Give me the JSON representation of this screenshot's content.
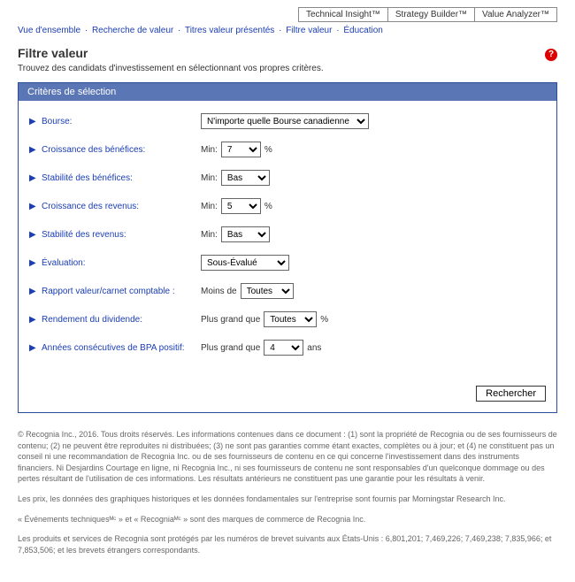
{
  "tabs": {
    "technical": "Technical Insight™",
    "strategy": "Strategy Builder™",
    "value": "Value Analyzer™"
  },
  "breadcrumbs": {
    "overview": "Vue d'ensemble",
    "search": "Recherche de valeur",
    "featured": "Titres valeur présentés",
    "filter": "Filtre valeur",
    "education": "Éducation"
  },
  "title": "Filtre valeur",
  "subtitle": "Trouvez des candidats d'investissement en sélectionnant vos propres critères.",
  "panel_header": "Critères de sélection",
  "help_symbol": "?",
  "rows": {
    "bourse": {
      "label": "Bourse:",
      "value": "N'importe quelle Bourse canadienne"
    },
    "croissance_benefices": {
      "label": "Croissance des bénéfices:",
      "prefix": "Min:",
      "value": "7",
      "suffix": "%"
    },
    "stabilite_benefices": {
      "label": "Stabilité des bénéfices:",
      "prefix": "Min:",
      "value": "Bas"
    },
    "croissance_revenus": {
      "label": "Croissance des revenus:",
      "prefix": "Min:",
      "value": "5",
      "suffix": "%"
    },
    "stabilite_revenus": {
      "label": "Stabilité des revenus:",
      "prefix": "Min:",
      "value": "Bas"
    },
    "evaluation": {
      "label": "Évaluation:",
      "value": "Sous-Évalué"
    },
    "rapport": {
      "label": "Rapport valeur/carnet comptable :",
      "prefix": "Moins de",
      "value": "Toutes"
    },
    "rendement": {
      "label": "Rendement du dividende:",
      "prefix": "Plus grand que",
      "value": "Toutes",
      "suffix": "%"
    },
    "annees": {
      "label": "Années consécutives de BPA positif:",
      "prefix": "Plus grand que",
      "value": "4",
      "suffix": "ans"
    }
  },
  "search_button": "Rechercher",
  "footnotes": {
    "p1": "© Recognia Inc., 2016. Tous droits réservés. Les informations contenues dans ce document : (1) sont la propriété de Recognia ou de ses fournisseurs de contenu; (2) ne peuvent être reproduites ni distribuées; (3) ne sont pas garanties comme étant exactes, complètes ou à jour; et (4) ne constituent pas un conseil ni une recommandation de Recognia Inc. ou de ses fournisseurs de contenu en ce qui concerne l'investissement dans des instruments financiers. Ni Desjardins Courtage en ligne, ni Recognia Inc., ni ses fournisseurs de contenu ne sont responsables d'un quelconque dommage ou des pertes résultant de l'utilisation de ces informations. Les résultats antérieurs ne constituent pas une garantie pour les résultats à venir.",
    "p2": "Les prix, les données des graphiques historiques et les données fondamentales sur l'entreprise sont fournis par Morningstar Research Inc.",
    "p3": "« Événements techniquesᴹᶜ » et « Recogniaᴹᶜ » sont des marques de commerce de Recognia Inc.",
    "p4": "Les produits et services de Recognia sont protégés par les numéros de brevet suivants aux États-Unis : 6,801,201; 7,469,226; 7,469,238; 7,835,966; et 7,853,506; et les brevets étrangers correspondants."
  }
}
